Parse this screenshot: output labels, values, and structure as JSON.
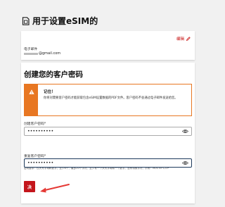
{
  "header": {
    "title": "用于设置eSIM的"
  },
  "email_card": {
    "edit_label": "编辑",
    "email_label": "电子邮件",
    "email_value": "@gmail.com"
  },
  "form": {
    "title": "创建您的客户密码",
    "alert": {
      "title": "记住！",
      "text": "你将对需要客户密码才能获取包含eSIM设置数据的PDF文件。客户密码不会通过电子邮件发送给您。"
    },
    "password": {
      "label": "创建客户密码*",
      "value": "••••••••••",
      "hint": "密码要求：仅大写字母和数字。至少6个，最多20个字符。至少有一个大写字母和一个数字。没有特殊字符。示例：MUSTEF123*"
    },
    "confirm": {
      "label": "重复客户密码*",
      "value": "••••••••••"
    },
    "submit_label": "决"
  },
  "colors": {
    "accent": "#c4161c",
    "warning": "#e87722",
    "focus_border": "#1e3a5c"
  }
}
